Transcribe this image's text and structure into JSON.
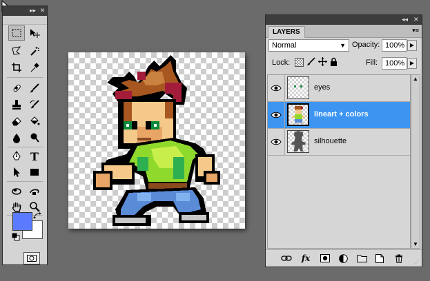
{
  "tools_panel": {
    "header_controls": [
      "▸▸",
      "✕"
    ],
    "tools": [
      {
        "name": "rectangular-marquee-icon",
        "selected": true
      },
      {
        "name": "move-icon"
      },
      {
        "name": "lasso-icon"
      },
      {
        "name": "magic-wand-icon"
      },
      {
        "name": "crop-icon"
      },
      {
        "name": "eyedropper-icon"
      },
      {
        "name": "healing-brush-icon"
      },
      {
        "name": "brush-icon"
      },
      {
        "name": "clone-stamp-icon"
      },
      {
        "name": "history-brush-icon"
      },
      {
        "name": "eraser-icon"
      },
      {
        "name": "paint-bucket-icon"
      },
      {
        "name": "blur-icon"
      },
      {
        "name": "dodge-icon"
      },
      {
        "name": "pen-icon"
      },
      {
        "name": "type-icon"
      },
      {
        "name": "path-selection-icon"
      },
      {
        "name": "rectangle-shape-icon"
      },
      {
        "name": "3d-rotate-icon"
      },
      {
        "name": "3d-orbit-icon"
      },
      {
        "name": "hand-icon"
      },
      {
        "name": "zoom-icon"
      }
    ],
    "type_tool_glyph": "T",
    "foreground_color": "#5a7bff",
    "background_color": "#ffffff"
  },
  "layers_panel": {
    "header_controls": [
      "◂◂",
      "✕"
    ],
    "tab_label": "LAYERS",
    "menu_glyph": "▾≡",
    "blend_mode": "Normal",
    "opacity_label": "Opacity:",
    "opacity_value": "100%",
    "lock_label": "Lock:",
    "fill_label": "Fill:",
    "fill_value": "100%",
    "layers": [
      {
        "name": "eyes",
        "visible": true,
        "selected": false
      },
      {
        "name": "lineart + colors",
        "visible": true,
        "selected": true
      },
      {
        "name": "silhouette",
        "visible": true,
        "selected": false
      }
    ],
    "footer_icons": [
      "link-layers-icon",
      "fx-icon",
      "layer-mask-icon",
      "adjustment-layer-icon",
      "new-group-icon",
      "new-layer-icon",
      "delete-layer-icon"
    ],
    "fx_label": "fx"
  },
  "colors": {
    "selection_blue": "#3d95f1",
    "panel_gray": "#d6d6d6",
    "workspace_gray": "#6b6b6b"
  }
}
